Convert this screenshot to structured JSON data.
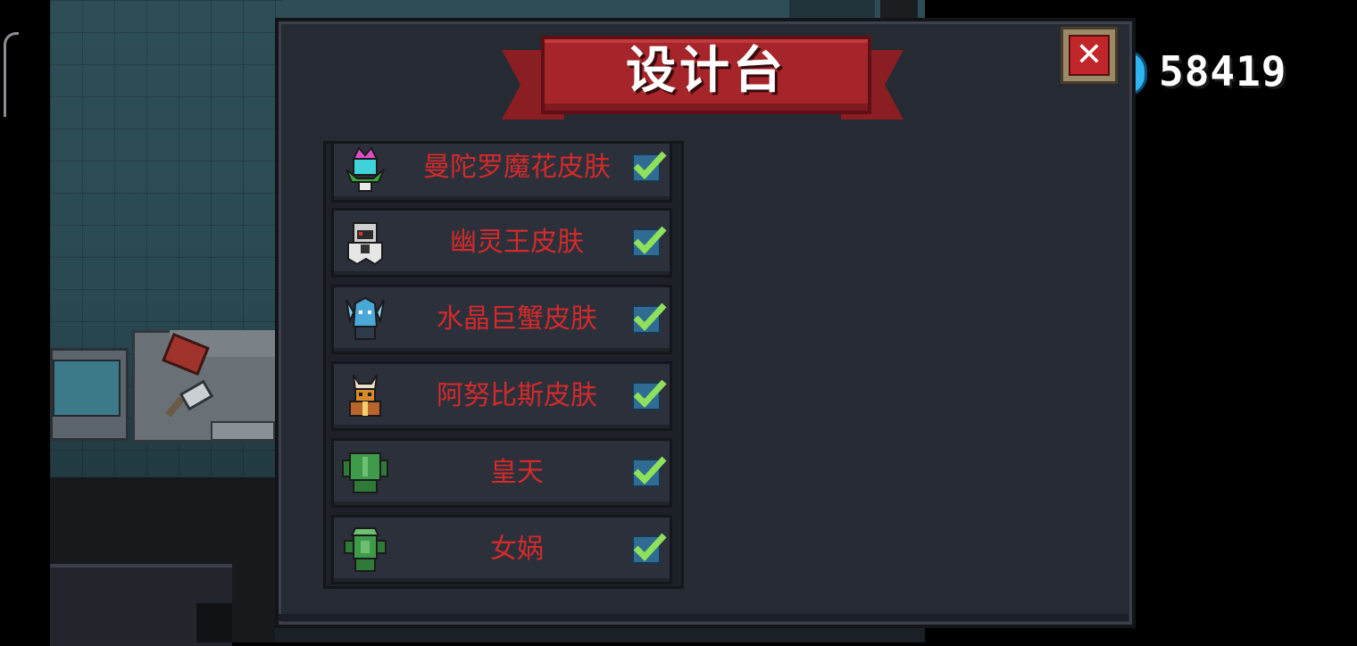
{
  "dialog": {
    "title": "设计台",
    "close_label": "✕"
  },
  "currency": {
    "gems": "58419",
    "icon": "gem-icon",
    "icon_color": "#2fb4f0"
  },
  "skins": [
    {
      "name": "曼陀罗魔花皮肤",
      "checked": true,
      "icon": "mandala-flower-avatar"
    },
    {
      "name": "幽灵王皮肤",
      "checked": true,
      "icon": "ghost-king-avatar"
    },
    {
      "name": "水晶巨蟹皮肤",
      "checked": true,
      "icon": "crystal-crab-avatar"
    },
    {
      "name": "阿努比斯皮肤",
      "checked": true,
      "icon": "anubis-avatar"
    },
    {
      "name": "皇天",
      "checked": true,
      "icon": "huangtian-avatar"
    },
    {
      "name": "女娲",
      "checked": true,
      "icon": "nuwa-avatar"
    }
  ],
  "colors": {
    "label_red": "#d42a2a",
    "banner_red": "#a5252a",
    "check_green": "#8fe05a"
  }
}
